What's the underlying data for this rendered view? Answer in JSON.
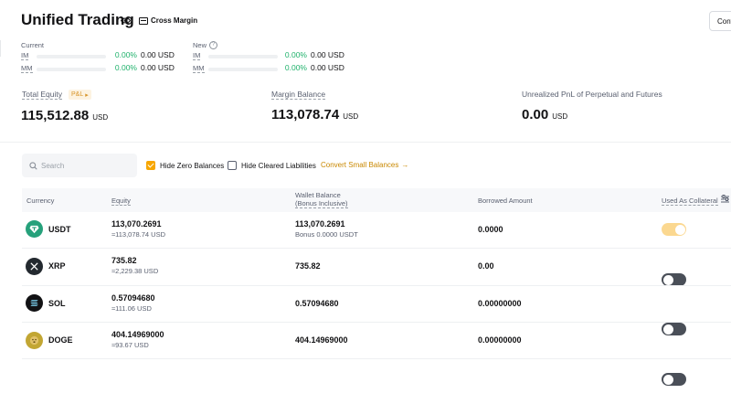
{
  "header": {
    "title": "Unified Trading",
    "margin_mode": "Cross Margin",
    "convert_label": "Convert"
  },
  "margin": {
    "current_label": "Current",
    "new_label": "New",
    "im_label": "IM",
    "mm_label": "MM",
    "current_im_pct": "0.00%",
    "current_im_usd": "0.00 USD",
    "current_mm_pct": "0.00%",
    "current_mm_usd": "0.00 USD",
    "new_im_pct": "0.00%",
    "new_im_usd": "0.00 USD",
    "new_mm_pct": "0.00%",
    "new_mm_usd": "0.00 USD"
  },
  "summary": {
    "total_equity_label": "Total Equity",
    "pnl_badge": "P&L",
    "total_equity_value": "115,512.88",
    "total_equity_unit": "USD",
    "margin_balance_label": "Margin Balance",
    "margin_balance_value": "113,078.74",
    "margin_balance_unit": "USD",
    "unrealized_label": "Unrealized PnL of Perpetual and Futures",
    "unrealized_value": "0.00",
    "unrealized_unit": "USD"
  },
  "filters": {
    "search_placeholder": "Search",
    "hide_zero_label": "Hide Zero Balances",
    "hide_zero_checked": true,
    "hide_cleared_label": "Hide Cleared Liabilities",
    "hide_cleared_checked": false,
    "convert_small_label": "Convert Small Balances"
  },
  "table": {
    "headers": {
      "currency": "Currency",
      "equity": "Equity",
      "wallet_line1": "Wallet Balance",
      "wallet_line2": "(Bonus Inclusive)",
      "borrowed": "Borrowed Amount",
      "collateral": "Used As Collateral"
    },
    "rows": [
      {
        "symbol": "USDT",
        "equity": "113,070.2691",
        "equity_usd": "≈113,078.74 USD",
        "wallet": "113,070.2691",
        "bonus": "Bonus 0.0000 USDT",
        "borrowed": "0.0000",
        "collateral_on": true,
        "icon": "usdt-icon",
        "color": "#26a17b"
      },
      {
        "symbol": "XRP",
        "equity": "735.82",
        "equity_usd": "≈2,229.38 USD",
        "wallet": "735.82",
        "bonus": "",
        "borrowed": "0.00",
        "collateral_on": false,
        "icon": "xrp-icon",
        "color": "#23292f"
      },
      {
        "symbol": "SOL",
        "equity": "0.57094680",
        "equity_usd": "≈111.06 USD",
        "wallet": "0.57094680",
        "bonus": "",
        "borrowed": "0.00000000",
        "collateral_on": false,
        "icon": "sol-icon",
        "color": "#121214"
      },
      {
        "symbol": "DOGE",
        "equity": "404.14969000",
        "equity_usd": "≈93.67 USD",
        "wallet": "404.14969000",
        "bonus": "",
        "borrowed": "0.00000000",
        "collateral_on": false,
        "icon": "doge-icon",
        "color": "#c2a633"
      }
    ]
  },
  "colors": {
    "accent": "#f7a600",
    "positive": "#20b26c",
    "toggle_off": "#4a4f58",
    "toggle_on": "#fbd890"
  }
}
